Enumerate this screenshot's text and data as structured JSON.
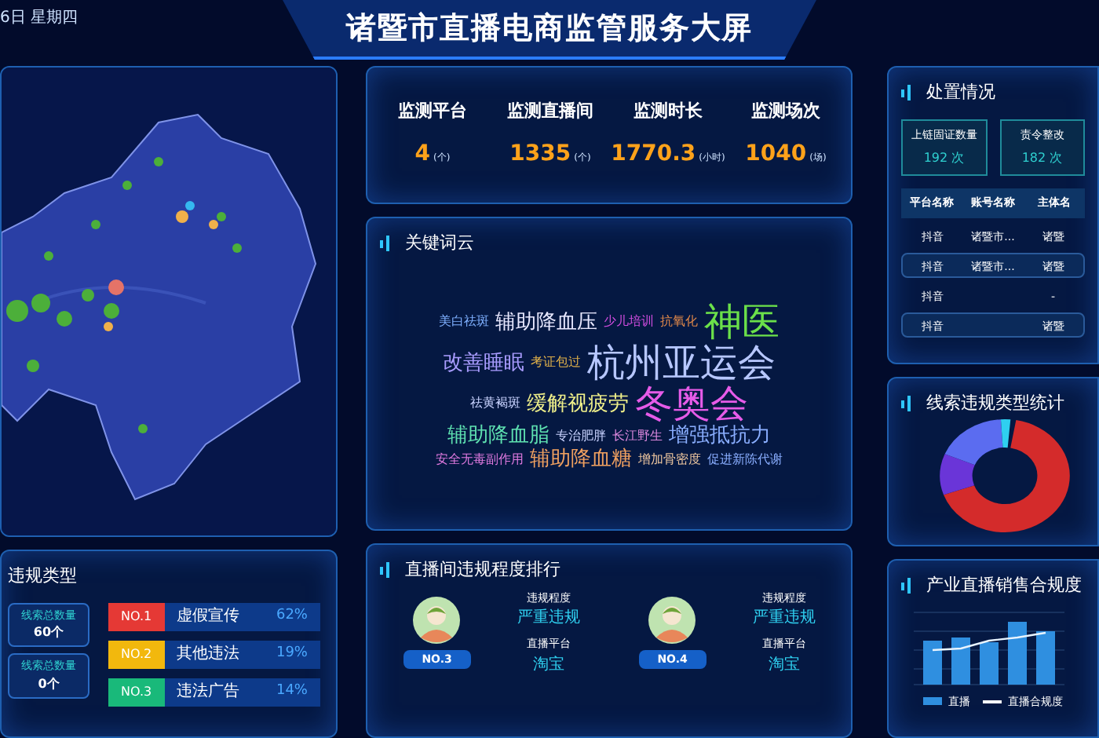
{
  "header": {
    "date": "6日 星期四",
    "title": "诸暨市直播电商监管服务大屏"
  },
  "violation_types": {
    "title": "违规类型",
    "counters": [
      {
        "label": "线索总数量",
        "value": "60个"
      },
      {
        "label": "线索总数量",
        "value": "0个"
      }
    ],
    "ranking": [
      {
        "rank": "NO.1",
        "name": "虚假宣传",
        "percent": "62%",
        "color": "#e53935"
      },
      {
        "rank": "NO.2",
        "name": "其他违法",
        "percent": "19%",
        "color": "#f2b80d"
      },
      {
        "rank": "NO.3",
        "name": "违法广告",
        "percent": "14%",
        "color": "#19b97a"
      }
    ]
  },
  "stats": [
    {
      "label": "监测平台",
      "value": "4",
      "unit": "(个)"
    },
    {
      "label": "监测直播间",
      "value": "1335",
      "unit": "(个)"
    },
    {
      "label": "监测时长",
      "value": "1770.3",
      "unit": "(小时)"
    },
    {
      "label": "监测场次",
      "value": "1040",
      "unit": "(场)"
    }
  ],
  "word_cloud": {
    "title": "关键词云",
    "words": [
      {
        "text": "美白祛斑",
        "kind": "small",
        "color": "#7fb0ff"
      },
      {
        "text": "辅助降血压",
        "kind": "medium",
        "color": "#e8e8ff"
      },
      {
        "text": "少儿培训",
        "kind": "small",
        "color": "#d14de0"
      },
      {
        "text": "抗氧化",
        "kind": "small",
        "color": "#e0884a"
      },
      {
        "text": "神医",
        "kind": "large",
        "color": "#6be04a"
      },
      {
        "text": "改善睡眠",
        "kind": "medium",
        "color": "#a99cff"
      },
      {
        "text": "考证包过",
        "kind": "small",
        "color": "#e0b04a"
      },
      {
        "text": "杭州亚运会",
        "kind": "large",
        "color": "#b7c7ff"
      },
      {
        "text": "祛黄褐斑",
        "kind": "small",
        "color": "#c9d3ff"
      },
      {
        "text": "缓解视疲劳",
        "kind": "medium",
        "color": "#f0f08a"
      },
      {
        "text": "冬奥会",
        "kind": "large",
        "color": "#e65be8"
      },
      {
        "text": "辅助降血脂",
        "kind": "medium",
        "color": "#5ee0b0"
      },
      {
        "text": "专治肥胖",
        "kind": "small",
        "color": "#c9d3ff"
      },
      {
        "text": "长江野生",
        "kind": "small",
        "color": "#e08ae0"
      },
      {
        "text": "增强抵抗力",
        "kind": "medium",
        "color": "#8aaeff"
      },
      {
        "text": "安全无毒副作用",
        "kind": "small",
        "color": "#e07ae0"
      },
      {
        "text": "辅助降血糖",
        "kind": "medium",
        "color": "#f0a060"
      },
      {
        "text": "增加骨密度",
        "kind": "small",
        "color": "#f0c8a0"
      },
      {
        "text": "促进新陈代谢",
        "kind": "small",
        "color": "#8aaeff"
      }
    ]
  },
  "live_ranking": {
    "title": "直播间违规程度排行",
    "items": [
      {
        "rank": "NO.3",
        "level_label": "违规程度",
        "level": "严重违规",
        "platform_label": "直播平台",
        "platform": "淘宝"
      },
      {
        "rank": "NO.4",
        "level_label": "违规程度",
        "level": "严重违规",
        "platform_label": "直播平台",
        "platform": "淘宝"
      }
    ]
  },
  "disposal": {
    "title": "处置情况",
    "cards": [
      {
        "label": "上链固证数量",
        "value": "192 次"
      },
      {
        "label": "责令整改",
        "value": "182 次"
      }
    ],
    "columns": [
      "平台名称",
      "账号名称",
      "主体名"
    ],
    "rows": [
      {
        "cells": [
          "抖音",
          "诸暨市...",
          "诸暨"
        ],
        "selected": false
      },
      {
        "cells": [
          "抖音",
          "诸暨市...",
          "诸暨"
        ],
        "selected": true
      },
      {
        "cells": [
          "抖音",
          "",
          "-"
        ],
        "selected": false
      },
      {
        "cells": [
          "抖音",
          "",
          "诸暨"
        ],
        "selected": true
      }
    ]
  },
  "clue_stats": {
    "title": "线索违规类型统计"
  },
  "sales": {
    "title": "产业直播销售合规度",
    "legend": [
      {
        "label": "直播",
        "kind": "bar"
      },
      {
        "label": "直播合规度",
        "kind": "line"
      }
    ]
  }
}
